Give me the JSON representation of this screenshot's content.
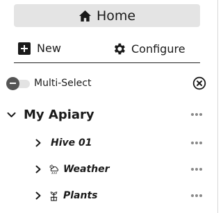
{
  "home": {
    "label": "Home",
    "icon": "home-icon"
  },
  "actions": {
    "new_label": "New",
    "new_icon": "plus-square-icon",
    "configure_label": "Configure",
    "configure_icon": "gear-icon"
  },
  "multiselect": {
    "label": "Multi-Select",
    "enabled": false,
    "clear_icon": "close-circle-icon"
  },
  "tree": {
    "root": {
      "label": "My Apiary",
      "expanded": true,
      "menu_icon": "more-horizontal-icon"
    },
    "items": [
      {
        "label": "Hive 01",
        "icon": null,
        "expanded": false
      },
      {
        "label": "Weather",
        "icon": "weather-icon",
        "expanded": false
      },
      {
        "label": "Plants",
        "icon": "plant-icon",
        "expanded": false
      }
    ]
  },
  "colors": {
    "button_bg": "#e4e4e4",
    "text": "#1a1a1a",
    "muted": "#888888"
  }
}
